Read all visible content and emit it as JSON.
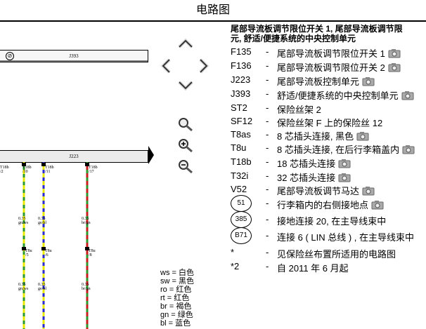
{
  "page": {
    "title": "电路图"
  },
  "diagram": {
    "top_component_label": "J393",
    "bar_component_label": "J223",
    "connectors": [
      {
        "name": "T18b",
        "pin": "/2"
      },
      {
        "name": "T18b",
        "pin": "/10"
      },
      {
        "name": "T18b",
        "pin": "/11"
      },
      {
        "name": "T18b",
        "pin": "/17"
      }
    ],
    "wire_specs": [
      {
        "size": "0.35",
        "color": "gn/ws"
      },
      {
        "size": "0.35",
        "color": "ge/bl"
      },
      {
        "size": "0.35",
        "color": "br/gn"
      }
    ],
    "lower_connectors": [
      {
        "name": "T8u",
        "pin": "/5"
      },
      {
        "name": "T8u",
        "pin": "/6"
      },
      {
        "name": "T8u",
        "pin": "/8"
      }
    ],
    "wire_colors": [
      "#e8e800",
      "#2a2ad0",
      "#2b9a2b",
      "#c81e1e"
    ]
  },
  "color_legend": [
    {
      "code": "ws",
      "meaning": "白色"
    },
    {
      "code": "sw",
      "meaning": "黑色"
    },
    {
      "code": "ro",
      "meaning": "红色"
    },
    {
      "code": "rt",
      "meaning": "红色"
    },
    {
      "code": "br",
      "meaning": "褐色"
    },
    {
      "code": "gn",
      "meaning": "绿色"
    },
    {
      "code": "bl",
      "meaning": "蓝色"
    }
  ],
  "panel": {
    "heading_line1": "尾部导流板调节限位开关 1, 尾部导流板调节限",
    "heading_line2": "元, 舒适/便捷系统的中央控制单元",
    "items": [
      {
        "code": "F135",
        "desc": "尾部导流板调节限位开关 1",
        "camera": true
      },
      {
        "code": "F136",
        "desc": "尾部导流板调节限位开关 2",
        "camera": true
      },
      {
        "code": "J223",
        "desc": "尾部导流板控制单元",
        "camera": true
      },
      {
        "code": "J393",
        "desc": "舒适/便捷系统的中央控制单元",
        "camera": true
      },
      {
        "code": "ST2",
        "desc": "保险丝架 2",
        "camera": false
      },
      {
        "code": "SF12",
        "desc": "保险丝架 F 上的保险丝 12",
        "camera": false
      },
      {
        "code": "T8as",
        "desc": "8 芯插头连接, 黑色",
        "camera": true
      },
      {
        "code": "T8u",
        "desc": "8 芯插头连接, 在后行李箱盖内",
        "camera": true
      },
      {
        "code": "T18b",
        "desc": "18 芯插头连接",
        "camera": true
      },
      {
        "code": "T32i",
        "desc": "32 芯插头连接",
        "camera": true
      },
      {
        "code": "V52",
        "desc": "尾部导流板调节马达",
        "camera": true
      },
      {
        "code": "51",
        "desc": "行李箱内的右侧接地点",
        "camera": true,
        "circle": true
      },
      {
        "code": "385",
        "desc": "接地连接 20, 在主导线束中",
        "camera": false,
        "circle": true
      },
      {
        "code": "B71",
        "desc": "连接 6 ( LIN 总线 ) , 在主导线束中",
        "camera": false,
        "circle": true
      },
      {
        "code": "*",
        "desc": "见保险丝布置所适用的电路图",
        "camera": false
      },
      {
        "code": "*2",
        "desc": "自 2011 年 6 月起",
        "camera": false
      }
    ]
  }
}
